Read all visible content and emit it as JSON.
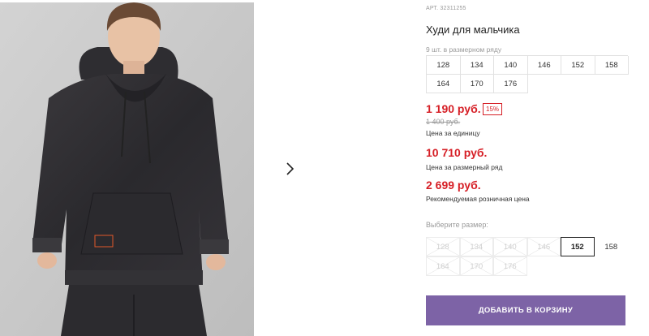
{
  "product": {
    "article": "АРТ. 32311255",
    "title": "Худи для мальчика",
    "photo_icon": "boy-in-hoodie-photo"
  },
  "gallery": {
    "next_icon": "chevron-right-icon"
  },
  "size_row": {
    "label": "9 шт. в размерном ряду",
    "sizes": [
      "128",
      "134",
      "140",
      "146",
      "152",
      "158",
      "164",
      "170",
      "176"
    ]
  },
  "prices": {
    "unit_price": "1 190 руб.",
    "discount_badge": "15%",
    "old_price": "1 400 руб.",
    "unit_caption": "Цена за единицу",
    "row_price": "10 710 руб.",
    "row_caption": "Цена за размерный ряд",
    "retail_price": "2 699 руб.",
    "retail_caption": "Рекомендуемая розничная цена"
  },
  "size_select": {
    "label": "Выберите размер:",
    "options": [
      {
        "label": "128",
        "state": "disabled"
      },
      {
        "label": "134",
        "state": "disabled"
      },
      {
        "label": "140",
        "state": "disabled"
      },
      {
        "label": "146",
        "state": "disabled"
      },
      {
        "label": "152",
        "state": "selected"
      },
      {
        "label": "158",
        "state": "available"
      },
      {
        "label": "164",
        "state": "disabled"
      },
      {
        "label": "170",
        "state": "disabled"
      },
      {
        "label": "176",
        "state": "disabled"
      }
    ]
  },
  "actions": {
    "add_to_cart": "Добавить в корзину"
  },
  "colors": {
    "accent": "#7d63a6",
    "price_red": "#d61f26"
  }
}
